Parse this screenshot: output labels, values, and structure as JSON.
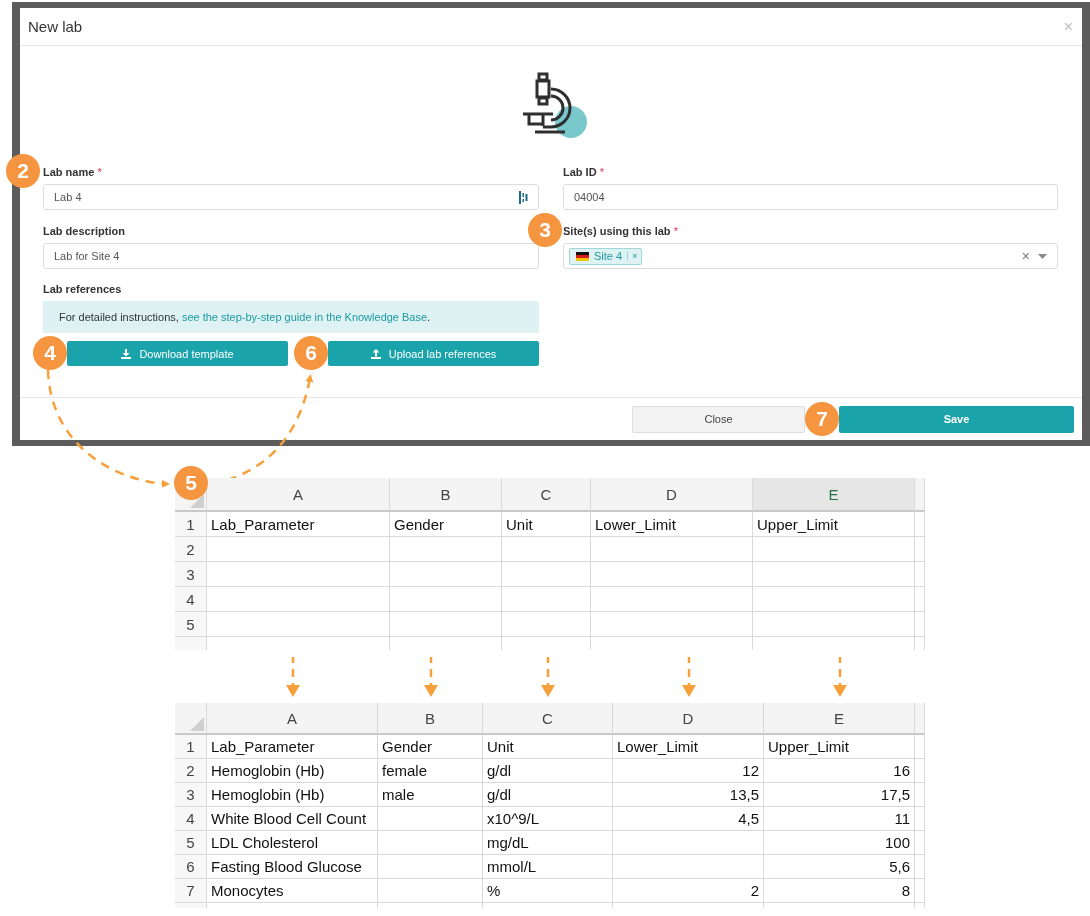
{
  "dialog": {
    "title": "New lab",
    "close": "×",
    "required_mark": "*",
    "fields": [
      {
        "kind": "text",
        "label": "Lab name",
        "required": true,
        "value": "Lab 4",
        "action_icon": true,
        "badge": "2"
      },
      {
        "kind": "text",
        "label": "Lab ID",
        "required": true,
        "value": "04004",
        "action_icon": false
      },
      {
        "kind": "text",
        "label": "Lab description",
        "required": false,
        "value": "Lab for Site 4",
        "action_icon": false
      },
      {
        "kind": "multiselect",
        "label": "Site(s) using this lab",
        "required": true,
        "tags": [
          {
            "label": "Site 4",
            "remove": "×"
          }
        ],
        "clear": "×",
        "badge": "3"
      }
    ],
    "references": {
      "label": "Lab references",
      "info_before": "For detailed instructions, ",
      "info_link": "see the step-by-step guide in the Knowledge Base",
      "info_after": ".",
      "buttons": [
        {
          "kind": "download",
          "label": "Download template",
          "badge": "4"
        },
        {
          "kind": "upload",
          "label": "Upload lab references",
          "badge": "6"
        }
      ]
    },
    "footer": [
      {
        "kind": "secondary",
        "label": "Close"
      },
      {
        "kind": "primary",
        "label": "Save",
        "badge": "7"
      }
    ]
  },
  "spreadsheets": [
    {
      "badge": "5",
      "columns": [
        {
          "letter": "A",
          "selected": false
        },
        {
          "letter": "B",
          "selected": false
        },
        {
          "letter": "C",
          "selected": false
        },
        {
          "letter": "D",
          "selected": false
        },
        {
          "letter": "E",
          "selected": true
        }
      ],
      "rows": [
        {
          "number": "1",
          "cells": [
            "Lab_Parameter",
            "Gender",
            "Unit",
            "Lower_Limit",
            "Upper_Limit"
          ]
        },
        {
          "number": "2"
        },
        {
          "number": "3"
        },
        {
          "number": "4"
        },
        {
          "number": "5"
        }
      ]
    },
    {
      "columns": [
        {
          "letter": "A",
          "selected": false
        },
        {
          "letter": "B",
          "selected": false
        },
        {
          "letter": "C",
          "selected": false
        },
        {
          "letter": "D",
          "selected": false
        },
        {
          "letter": "E",
          "selected": false
        }
      ],
      "rows": [
        {
          "number": "1",
          "cells": [
            "Lab_Parameter",
            "Gender",
            "Unit",
            "Lower_Limit",
            "Upper_Limit"
          ]
        },
        {
          "number": "2",
          "cells": [
            "Hemoglobin (Hb)",
            "female",
            "g/dl",
            "12",
            "16"
          ]
        },
        {
          "number": "3",
          "cells": [
            "Hemoglobin (Hb)",
            "male",
            "g/dl",
            "13,5",
            "17,5"
          ]
        },
        {
          "number": "4",
          "cells": [
            "White Blood Cell Count",
            null,
            "x10^9/L",
            "4,5",
            "11"
          ]
        },
        {
          "number": "5",
          "cells": [
            "LDL Cholesterol",
            null,
            "mg/dL",
            null,
            "100"
          ]
        },
        {
          "number": "6",
          "cells": [
            "Fasting Blood Glucose",
            null,
            "mmol/L",
            null,
            "5,6"
          ]
        },
        {
          "number": "7",
          "cells": [
            "Monocytes",
            null,
            "%",
            "2",
            "8"
          ]
        }
      ]
    }
  ]
}
